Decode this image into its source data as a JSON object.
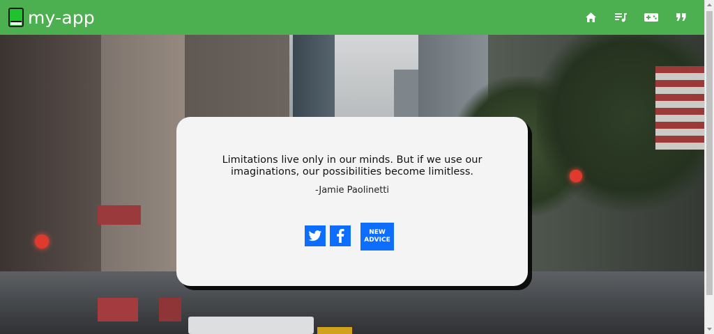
{
  "app": {
    "title": "my-app",
    "brand_icon": "book-icon",
    "accent_color": "#4caf50"
  },
  "nav": {
    "icons": [
      "home-icon",
      "playlist-icon",
      "gamepad-icon",
      "quote-icon"
    ]
  },
  "quote": {
    "text": "Limitations live only in our minds. But if we use our imaginations, our possibilities become limitless.",
    "author": "-Jamie Paolinetti"
  },
  "actions": {
    "twitter_icon": "twitter-icon",
    "facebook_icon": "facebook-icon",
    "new_advice_label": "NEW ADVICE",
    "button_color": "#0d6efd"
  }
}
